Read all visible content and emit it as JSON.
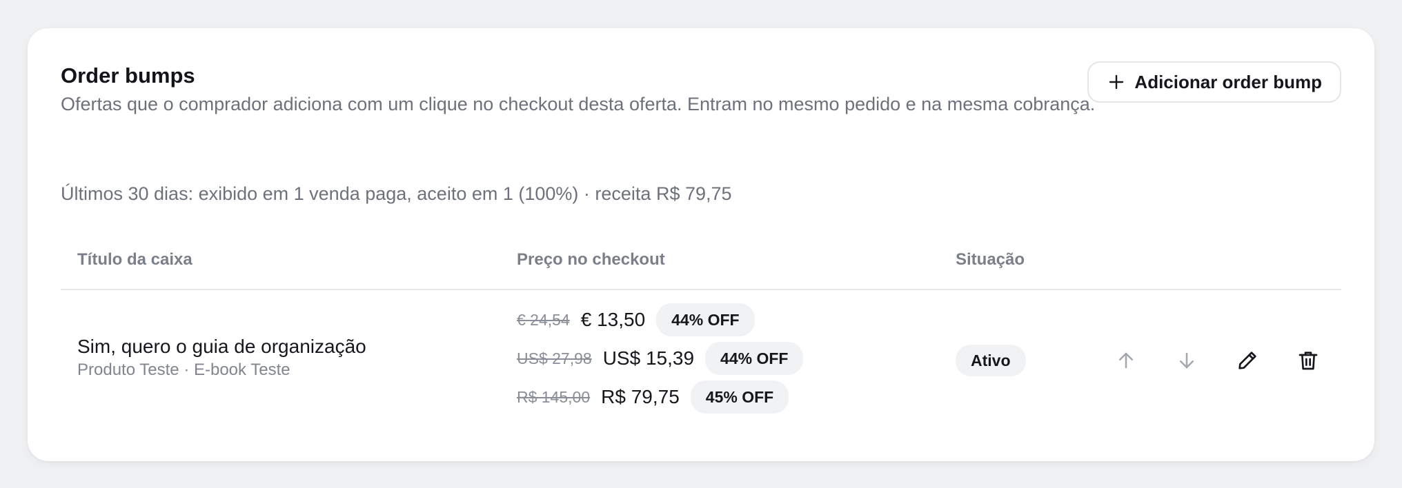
{
  "section": {
    "title": "Order bumps",
    "description": "Ofertas que o comprador adiciona com um clique no checkout desta oferta. Entram no mesmo pedido e na mesma cobrança.",
    "add_button": "Adicionar order bump",
    "stats": "Últimos 30 dias: exibido em 1 venda paga, aceito em 1 (100%) · receita R$ 79,75"
  },
  "table": {
    "columns": [
      "Título da caixa",
      "Preço no checkout",
      "Situação"
    ],
    "rows": [
      {
        "title": "Sim, quero o guia de organização",
        "subtitle": "Produto Teste · E-book Teste",
        "prices": [
          {
            "old": "€ 24,54",
            "new": "€ 13,50",
            "discount": "44% OFF"
          },
          {
            "old": "US$ 27,98",
            "new": "US$ 15,39",
            "discount": "44% OFF"
          },
          {
            "old": "R$ 145,00",
            "new": "R$ 79,75",
            "discount": "45% OFF"
          }
        ],
        "status": "Ativo",
        "actions": [
          "arrow-up-icon",
          "arrow-down-icon",
          "pencil-icon",
          "trash-icon"
        ]
      }
    ]
  },
  "colors": {
    "page_bg": "#f0f1f3",
    "card_bg": "#ffffff",
    "muted_text": "#6c717c",
    "badge_bg": "#f1f2f4",
    "disabled_icon": "#a3a7ae"
  }
}
